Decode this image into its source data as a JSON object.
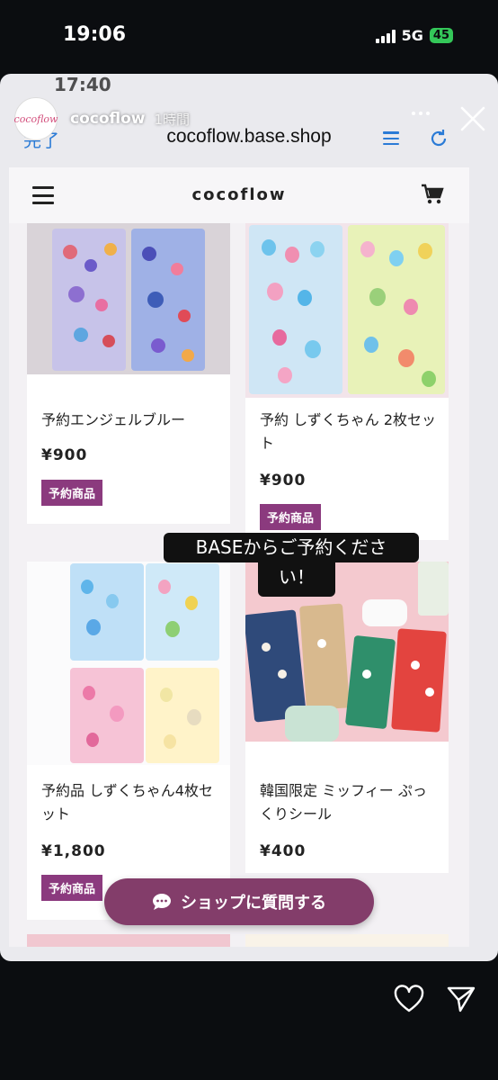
{
  "status_bar": {
    "time": "19:06",
    "network": "5G",
    "battery": "45"
  },
  "story": {
    "username": "cocoflow",
    "posted_ago": "1時間",
    "avatar_text": "cocoflow",
    "caption": "BASEからご予約ください！",
    "caption_line1": "BASEからご予約くださ",
    "caption_line2": "い！"
  },
  "browser": {
    "inner_time": "17:40",
    "done_label": "完了",
    "url": "cocoflow.base.shop"
  },
  "site": {
    "brand": "cocoflow",
    "products": [
      {
        "name": "予約エンジェルブルー",
        "price": "¥900",
        "badge": "予約商品"
      },
      {
        "name": "予約 しずくちゃん 2枚セット",
        "price": "¥900",
        "badge": "予約商品"
      },
      {
        "name": "予約品 しずくちゃん4枚セット",
        "price": "¥1,800",
        "badge": "予約商品"
      },
      {
        "name": "韓国限定 ミッフィー ぷっくりシール",
        "price": "¥400"
      }
    ],
    "question_button": "ショップに質問する"
  },
  "icons": [
    "more-icon",
    "close-icon",
    "list-icon",
    "reload-icon",
    "menu-icon",
    "cart-icon",
    "chat-icon",
    "heart-icon",
    "send-icon"
  ],
  "colors": {
    "badge": "#8b3a7e",
    "question_button": "#833d6a",
    "battery": "#34c759"
  }
}
